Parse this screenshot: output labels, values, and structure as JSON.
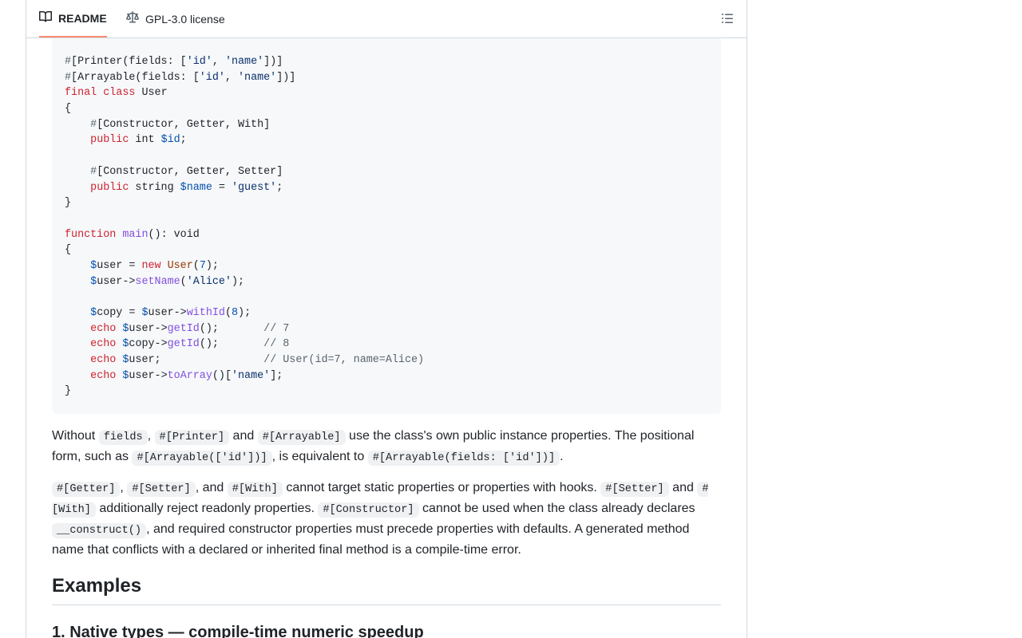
{
  "tabs": {
    "readme": "README",
    "license": "GPL-3.0 license"
  },
  "code": {
    "l1": {
      "hash": "#",
      "a": "[Printer(fields: [",
      "s1": "'id'",
      "b": ", ",
      "s2": "'name'",
      "c": "])]"
    },
    "l2": {
      "hash": "#",
      "a": "[Arrayable(fields: [",
      "s1": "'id'",
      "b": ", ",
      "s2": "'name'",
      "c": "])]"
    },
    "l3": {
      "kw1": "final",
      "kw2": "class",
      "name": " User"
    },
    "brace_open": "{",
    "brace_close": "}",
    "l5": {
      "hash": "#",
      "a": "[Constructor, Getter, With]"
    },
    "l6": {
      "kw": "public",
      "type": " int ",
      "var": "$id",
      "end": ";"
    },
    "l8": {
      "hash": "#",
      "a": "[Constructor, Getter, Setter]"
    },
    "l9": {
      "kw": "public",
      "type": " string ",
      "var": "$name",
      "eq": " = ",
      "str": "'guest'",
      "end": ";"
    },
    "l12": {
      "kw": "function",
      "fn": "main",
      "rest": "(): void"
    },
    "l14": {
      "d": "$",
      "a": "user = ",
      "kw": "new",
      "cls": "User",
      "p1": "(",
      "num": "7",
      "p2": ");"
    },
    "l15": {
      "d": "$",
      "a": "user->",
      "fn": "setName",
      "p1": "(",
      "str": "'Alice'",
      "p2": ");"
    },
    "l17": {
      "d1": "$",
      "a": "copy = ",
      "d2": "$",
      "b": "user->",
      "fn": "withId",
      "p1": "(",
      "num": "8",
      "p2": ");"
    },
    "l18": {
      "kw": "echo",
      "d": "$",
      "a": "user->",
      "fn": "getId",
      "p": "();       ",
      "cm": "// 7"
    },
    "l19": {
      "kw": "echo",
      "d": "$",
      "a": "copy->",
      "fn": "getId",
      "p": "();       ",
      "cm": "// 8"
    },
    "l20": {
      "kw": "echo",
      "d": "$",
      "a": "user;                ",
      "cm": "// User(id=7, name=Alice)"
    },
    "l21": {
      "kw": "echo",
      "d": "$",
      "a": "user->",
      "fn": "toArray",
      "p1": "()[",
      "str": "'name'",
      "p2": "];"
    }
  },
  "para1": {
    "t1": "Without ",
    "c1": "fields",
    "t2": ", ",
    "c2": "#[Printer]",
    "t3": " and ",
    "c3": "#[Arrayable]",
    "t4": " use the class's own public instance properties. The positional form, such as ",
    "c4": "#[Arrayable(['id'])]",
    "t5": ", is equivalent to ",
    "c5": "#[Arrayable(fields: ['id'])]",
    "t6": "."
  },
  "para2": {
    "c1": "#[Getter]",
    "t1": ", ",
    "c2": "#[Setter]",
    "t2": ", and ",
    "c3": "#[With]",
    "t3": " cannot target static properties or properties with hooks. ",
    "c4": "#[Setter]",
    "t4": " and ",
    "c5": "#[With]",
    "t5": " additionally reject readonly properties. ",
    "c6": "#[Constructor]",
    "t6": " cannot be used when the class already declares ",
    "c7": "__construct()",
    "t7": ", and required constructor properties must precede properties with defaults. A generated method name that conflicts with a declared or inherited final method is a compile-time error."
  },
  "headings": {
    "examples": "Examples",
    "native_types": "1. Native types — compile-time numeric speedup"
  },
  "icons": {
    "readme": "book-icon",
    "license": "law-icon",
    "outline": "list-unordered-icon"
  },
  "colors": {
    "active_tab_underline": "#fd8c73",
    "keyword": "#cf222e",
    "string": "#0a3069",
    "variable": "#0550ae",
    "function": "#8250df",
    "comment": "#59636e"
  }
}
